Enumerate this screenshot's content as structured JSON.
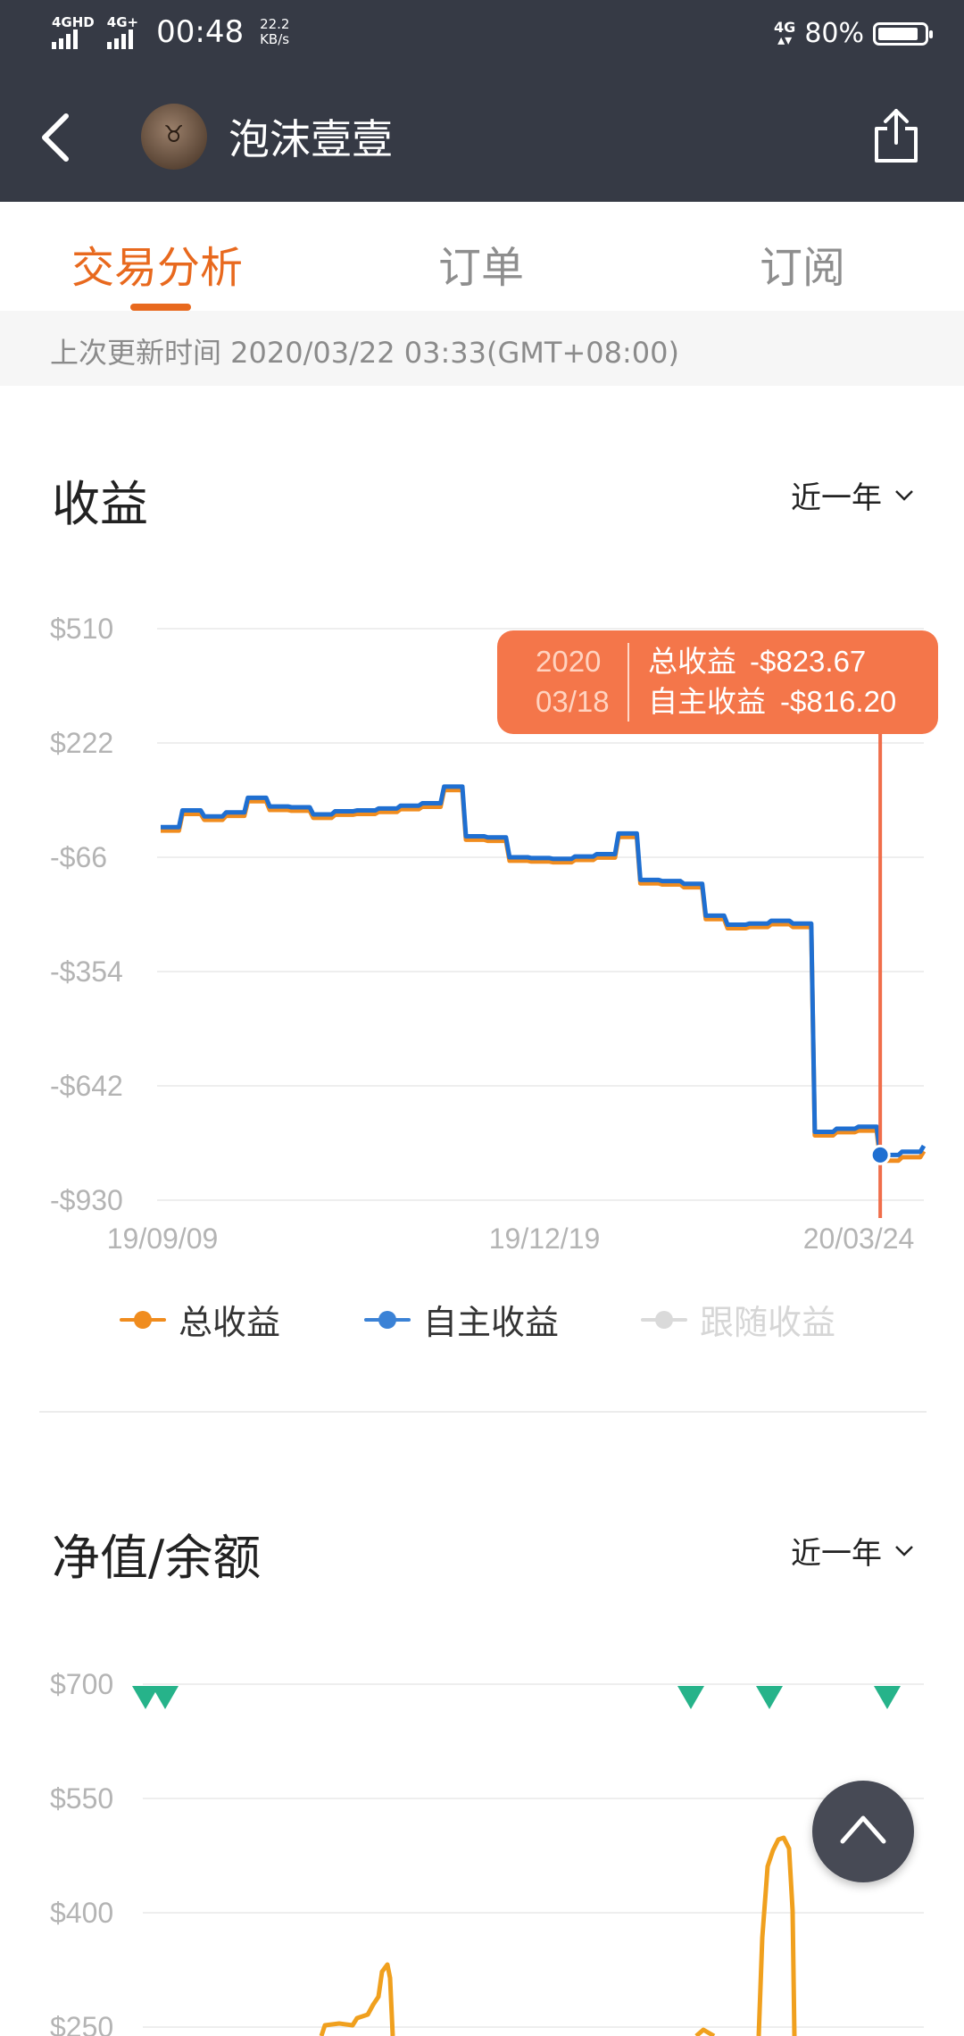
{
  "status_bar": {
    "sim1": "4GHD",
    "sim2": "4G+",
    "time": "00:48",
    "speed_value": "22.2",
    "speed_unit": "KB/s",
    "network": "4G",
    "battery": "80%"
  },
  "nav": {
    "title": "泡沫壹壹"
  },
  "tabs": [
    {
      "label": "交易分析",
      "active": true
    },
    {
      "label": "订单",
      "active": false
    },
    {
      "label": "订阅",
      "active": false
    }
  ],
  "update_time": "上次更新时间 2020/03/22 03:33(GMT+08:00)",
  "profit": {
    "title": "收益",
    "range": "近一年",
    "y_ticks": [
      "$510",
      "$222",
      "-$66",
      "-$354",
      "-$642",
      "-$930"
    ],
    "x_ticks": [
      "19/09/09",
      "19/12/19",
      "20/03/24"
    ],
    "tooltip": {
      "year": "2020",
      "date": "03/18",
      "total_label": "总收益",
      "total_value": "-$823.67",
      "self_label": "自主收益",
      "self_value": "-$816.20"
    },
    "legend": [
      {
        "label": "总收益",
        "color": "#f08c1e",
        "active": true
      },
      {
        "label": "自主收益",
        "color": "#3b82d6",
        "active": true
      },
      {
        "label": "跟随收益",
        "color": "#dadada",
        "active": false
      }
    ]
  },
  "equity": {
    "title": "净值/余额",
    "range": "近一年",
    "y_ticks": [
      "$700",
      "$550",
      "$400",
      "$250"
    ]
  },
  "chart_data": [
    {
      "type": "line",
      "ylim": [
        -930,
        510
      ],
      "x": [
        "19/09/09",
        "19/09/12",
        "19/09/16",
        "19/09/20",
        "19/09/27",
        "19/10/03",
        "19/10/10",
        "19/10/17",
        "19/10/24",
        "19/10/31",
        "19/11/07",
        "19/11/14",
        "19/11/21",
        "19/11/28",
        "19/12/03",
        "19/12/06",
        "19/12/10",
        "19/12/13",
        "19/12/19",
        "19/12/26",
        "20/01/02",
        "20/01/09",
        "20/01/16",
        "20/01/23",
        "20/01/30",
        "20/02/06",
        "20/02/13",
        "20/02/20",
        "20/02/27",
        "20/03/02",
        "20/03/05",
        "20/03/10",
        "20/03/15",
        "20/03/18",
        "20/03/22",
        "20/03/24"
      ],
      "series": [
        {
          "name": "总收益",
          "color": "#f08c1e",
          "values": [
            8,
            50,
            35,
            45,
            82,
            60,
            58,
            40,
            48,
            50,
            55,
            62,
            68,
            110,
            -15,
            -18,
            -68,
            -70,
            -72,
            -66,
            -60,
            -8,
            -125,
            -128,
            -135,
            -215,
            -238,
            -235,
            -228,
            -235,
            -760,
            -752,
            -748,
            -823.67,
            -815,
            -800
          ]
        },
        {
          "name": "自主收益",
          "color": "#3b82d6",
          "values": [
            10,
            52,
            37,
            47,
            84,
            62,
            60,
            42,
            50,
            52,
            57,
            64,
            70,
            112,
            -13,
            -16,
            -66,
            -68,
            -70,
            -64,
            -58,
            -6,
            -123,
            -126,
            -133,
            -213,
            -236,
            -233,
            -226,
            -233,
            -758,
            -750,
            -745,
            -816.2,
            -808,
            -793
          ]
        }
      ]
    },
    {
      "type": "line",
      "ylim": [
        250,
        700
      ],
      "series": [
        {
          "name": "",
          "color": "#f0a01e"
        }
      ]
    }
  ]
}
